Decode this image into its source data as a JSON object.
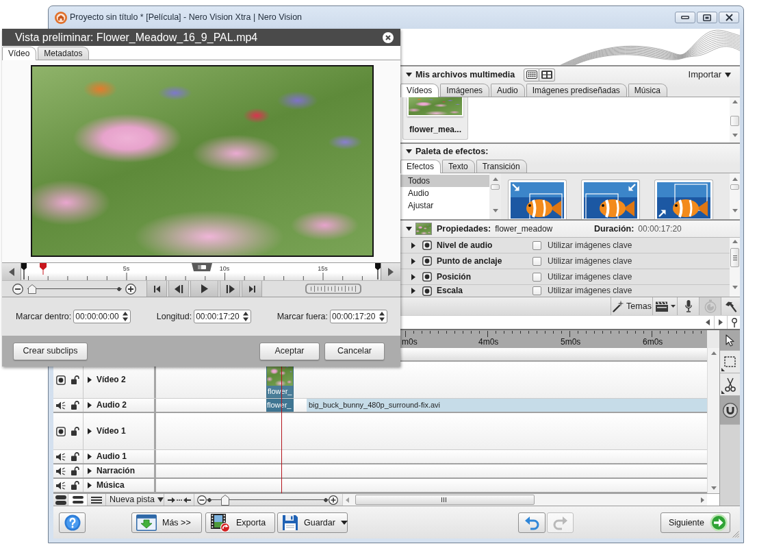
{
  "window": {
    "title": "Proyecto sin título * [Película] - Nero Vision Xtra | Nero Vision"
  },
  "preview": {
    "title": "Vista preliminar: Flower_Meadow_16_9_PAL.mp4",
    "tabs": [
      {
        "label": "Vídeo",
        "selected": true
      },
      {
        "label": "Metadatos",
        "selected": false
      }
    ],
    "scrubber": {
      "ticks": [
        "5s",
        "10s",
        "15s"
      ],
      "level": 0.06
    },
    "zoom": {
      "level": 0.02
    },
    "transport": [
      {
        "kind": "skip-start"
      },
      {
        "kind": "step-back"
      },
      {
        "kind": "play"
      },
      {
        "kind": "step-forward"
      },
      {
        "kind": "skip-end"
      }
    ],
    "fields": [
      {
        "label": "Marcar dentro:",
        "value": "00:00:00:00"
      },
      {
        "label": "Longitud:",
        "value": "00:00:17:20"
      },
      {
        "label": "Marcar fuera:",
        "value": "00:00:17:20"
      }
    ],
    "buttons": [
      "Crear subclips",
      "Aceptar",
      "Cancelar"
    ]
  },
  "media_panel": {
    "title": "Mis archivos multimedia",
    "expanded": true,
    "view_modes": [
      {
        "kind": "grid",
        "selected": false
      },
      {
        "kind": "thumbnails",
        "selected": false
      }
    ],
    "import_label": "Importar",
    "tabs": [
      {
        "label": "Vídeos",
        "selected": true
      },
      {
        "label": "Imágenes",
        "selected": false
      },
      {
        "label": "Audio",
        "selected": false
      },
      {
        "label": "Imágenes prediseñadas",
        "selected": false
      },
      {
        "label": "Música",
        "selected": false
      }
    ],
    "items": [
      {
        "label": "flower_mea..."
      }
    ]
  },
  "effects_panel": {
    "title": "Paleta de efectos:",
    "expanded": true,
    "tabs": [
      {
        "label": "Efectos",
        "selected": true
      },
      {
        "label": "Texto",
        "selected": false
      },
      {
        "label": "Transición",
        "selected": false
      }
    ],
    "categories": [
      {
        "label": "Todos",
        "selected": true
      },
      {
        "label": "Audio",
        "selected": false
      },
      {
        "label": "Ajustar",
        "selected": false
      }
    ],
    "effects": [
      {
        "kind": "topleft"
      },
      {
        "kind": "topright"
      },
      {
        "kind": "bottomleft"
      }
    ]
  },
  "properties_panel": {
    "title": "Propiedades:",
    "expanded": true,
    "clip": "flower_meadow",
    "duration_label": "Duración:",
    "duration": "00:00:17:20",
    "rows": [
      {
        "name": "Nivel de audio",
        "expanded": false,
        "checked": false,
        "option": "Utilizar imágenes clave"
      },
      {
        "name": "Punto de anclaje",
        "expanded": false,
        "checked": false,
        "option": "Utilizar imágenes clave"
      },
      {
        "name": "Posición",
        "expanded": false,
        "checked": false,
        "option": "Utilizar imágenes clave"
      },
      {
        "name": "Escala",
        "expanded": false,
        "checked": false,
        "option": "Utilizar imágenes clave"
      }
    ]
  },
  "toolbar": {
    "themes_label": "Temas",
    "tools": [
      {
        "kind": "clapperboard",
        "disabled": false
      },
      {
        "kind": "microphone",
        "disabled": false
      },
      {
        "kind": "stopwatch",
        "disabled": true
      },
      {
        "kind": "hammer",
        "disabled": false
      }
    ]
  },
  "timeline": {
    "ruler": [
      "m0s",
      "4m0s",
      "5m0s",
      "6m0s"
    ],
    "tools": [
      {
        "kind": "pointer",
        "active": true
      },
      {
        "kind": "select",
        "active": false
      },
      {
        "kind": "cut",
        "active": false
      },
      {
        "kind": "magnet",
        "active": true
      }
    ],
    "tracks": [
      {
        "name": "Vídeo 2",
        "kind": "video",
        "expanded": false,
        "locked": false,
        "clips": [
          {
            "label": "flower_",
            "kind": "video",
            "selected": true
          }
        ]
      },
      {
        "name": "Audio 2",
        "kind": "audio",
        "expanded": false,
        "locked": false,
        "clips": [
          {
            "label": "flower_",
            "kind": "audio",
            "selected": true
          },
          {
            "label": "big_buck_bunny_480p_surround-fix.avi",
            "kind": "audio",
            "selected": false
          }
        ]
      },
      {
        "name": "Vídeo 1",
        "kind": "video",
        "expanded": false,
        "locked": false
      },
      {
        "name": "Audio 1",
        "kind": "audio",
        "expanded": false,
        "locked": false
      },
      {
        "name": "Narración",
        "kind": "audio",
        "expanded": false,
        "locked": false
      },
      {
        "name": "Música",
        "kind": "audio",
        "expanded": false,
        "locked": false
      }
    ],
    "track_sizes": [
      {
        "kind": "large",
        "selected": false
      },
      {
        "kind": "medium",
        "selected": true
      },
      {
        "kind": "small",
        "selected": false
      }
    ],
    "new_track_label": "Nueva pista",
    "zoom": {
      "level": 0.15
    }
  },
  "footer": {
    "more_label": "Más >>",
    "export_label": "Exporta",
    "save_label": "Guardar",
    "history": [
      {
        "kind": "undo",
        "disabled": false
      },
      {
        "kind": "redo",
        "disabled": true
      }
    ],
    "next_label": "Siguiente"
  }
}
